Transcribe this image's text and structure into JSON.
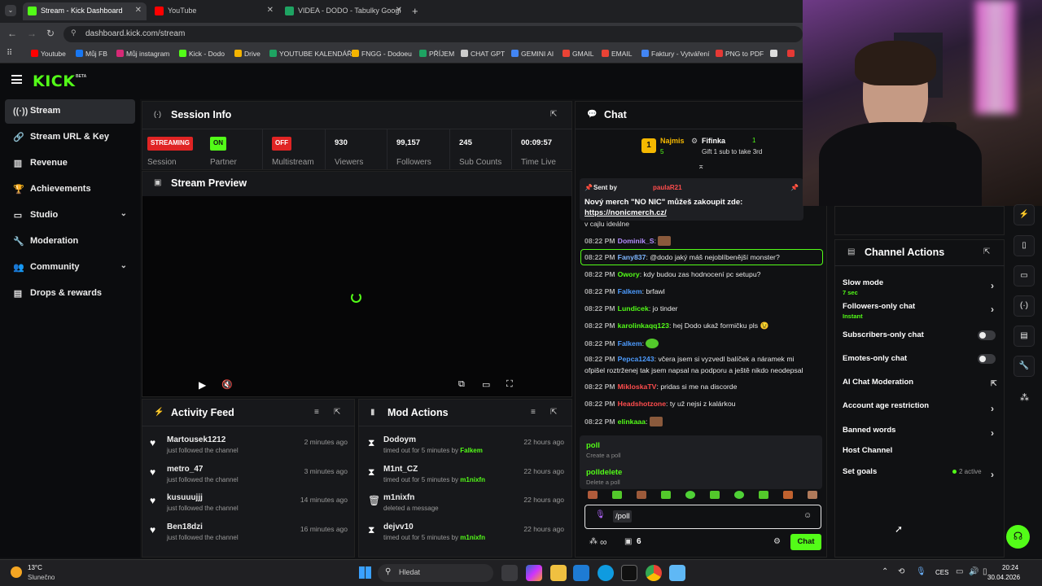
{
  "browser": {
    "tabs": [
      {
        "title": "Stream - Kick Dashboard",
        "color": "#53fc18"
      },
      {
        "title": "YouTube",
        "color": "#ff0000"
      },
      {
        "title": "VIDEA - DODO - Tabulky Googl",
        "color": "#1ea362"
      }
    ],
    "url": "dashboard.kick.com/stream",
    "bookmarks": [
      {
        "label": "Youtube",
        "color": "#ff0000"
      },
      {
        "label": "Můj FB",
        "color": "#1877f2"
      },
      {
        "label": "Můj instagram",
        "color": "#d62976"
      },
      {
        "label": "Kick - Dodo",
        "color": "#53fc18"
      },
      {
        "label": "Drive",
        "color": "#f4b400"
      },
      {
        "label": "YOUTUBE KALENDÁŘ",
        "color": "#1ea362"
      },
      {
        "label": "FNGG - Dodoeu",
        "color": "#f4b400"
      },
      {
        "label": "PŘÍJEM",
        "color": "#1ea362"
      },
      {
        "label": "CHAT GPT",
        "color": "#cccccc"
      },
      {
        "label": "GEMINI AI",
        "color": "#4285f4"
      },
      {
        "label": "GMAIL",
        "color": "#ea4335"
      },
      {
        "label": "EMAIL",
        "color": "#ea4335"
      },
      {
        "label": "Faktury - Vytváření",
        "color": "#4285f4"
      },
      {
        "label": "PNG to PDF",
        "color": "#e53935"
      },
      {
        "label": "",
        "color": "#dddddd"
      },
      {
        "label": "",
        "color": "#e53935"
      }
    ]
  },
  "brand": {
    "logo": "KICK",
    "beta": "BETA",
    "accent": "#53fc18"
  },
  "sidebar": {
    "items": [
      {
        "label": "Stream",
        "icon": "broadcast-icon"
      },
      {
        "label": "Stream URL & Key",
        "icon": "link-icon"
      },
      {
        "label": "Revenue",
        "icon": "chart-icon"
      },
      {
        "label": "Achievements",
        "icon": "trophy-icon"
      },
      {
        "label": "Studio",
        "icon": "monitor-icon"
      },
      {
        "label": "Moderation",
        "icon": "wrench-icon"
      },
      {
        "label": "Community",
        "icon": "users-icon"
      },
      {
        "label": "Drops & rewards",
        "icon": "gift-icon"
      }
    ]
  },
  "session": {
    "title": "Session Info",
    "streaming": "STREAMING",
    "streaming_label": "Session",
    "partner_badge": "ON",
    "partner_label": "Partner",
    "multistream_badge": "OFF",
    "multistream_label": "Multistream",
    "viewers": "930",
    "viewers_label": "Viewers",
    "followers": "99,157",
    "followers_label": "Followers",
    "subs": "245",
    "subs_label": "Sub Counts",
    "time": "00:09:57",
    "time_label": "Time Live"
  },
  "preview": {
    "title": "Stream Preview"
  },
  "activity": {
    "title": "Activity Feed",
    "items": [
      {
        "name": "Martousek1212",
        "action": "just followed the channel",
        "time": "2 minutes ago"
      },
      {
        "name": "metro_47",
        "action": "just followed the channel",
        "time": "3 minutes ago"
      },
      {
        "name": "kusuuujjj",
        "action": "just followed the channel",
        "time": "14 minutes ago"
      },
      {
        "name": "Ben18dzi",
        "action": "just followed the channel",
        "time": "16 minutes ago"
      }
    ]
  },
  "mod": {
    "title": "Mod Actions",
    "items": [
      {
        "name": "Dodoym",
        "action": "timed out for 5 minutes by",
        "by": "Falkem",
        "time": "22 hours ago"
      },
      {
        "name": "M1nt_CZ",
        "action": "timed out for 5 minutes by",
        "by": "m1nixfn",
        "time": "22 hours ago"
      },
      {
        "name": "m1nixfn",
        "action": "deleted a message",
        "by": "",
        "time": "22 hours ago"
      },
      {
        "name": "dejvv10",
        "action": "timed out for 5 minutes by",
        "by": "m1nixfn",
        "time": "22 hours ago"
      }
    ]
  },
  "chat": {
    "title": "Chat",
    "leaders": [
      {
        "name": "Najmis",
        "count": "5",
        "rank": "1"
      },
      {
        "name": "Fifinka",
        "count": "1",
        "note": "Gift 1 sub to take 3rd"
      }
    ],
    "pinned": {
      "sent_by": "Sent by",
      "user": "paulaR21",
      "text": "Nový merch \"NO NIC\" můžeš zakoupit zde:",
      "link": "https://nonicmerch.cz/"
    },
    "partial_line": "v cajlu ideálne",
    "messages": [
      {
        "time": "08:22 PM",
        "user": "Dominik_S",
        "color": "#b48cff",
        "text": ""
      },
      {
        "time": "08:22 PM",
        "user": "Fany837",
        "color": "#7eb6ff",
        "text": "@dodo jaký máš nejoblíbenější monster?"
      },
      {
        "time": "08:22 PM",
        "user": "Owory",
        "color": "#53fc18",
        "text": "kdy budou zas hodnocení pc setupu?"
      },
      {
        "time": "08:22 PM",
        "user": "Falkem",
        "color": "#4d9cff",
        "text": "brfawl"
      },
      {
        "time": "08:22 PM",
        "user": "Lundicek",
        "color": "#53fc18",
        "text": "jo tinder"
      },
      {
        "time": "08:22 PM",
        "user": "karolinkaqq123",
        "color": "#53fc18",
        "text": "hej Dodo ukaž formičku pls 😉"
      },
      {
        "time": "08:22 PM",
        "user": "Falkem",
        "color": "#4d9cff",
        "text": ""
      },
      {
        "time": "08:22 PM",
        "user": "Pepca1243",
        "color": "#4d9cff",
        "text": "včera jsem si vyzvedl balíček a náramek mi"
      },
      {
        "time": "",
        "user": "",
        "color": "#e8e8e8",
        "text": "ofpišel roztrženej tak jsem napsal na podporu a ještě nikdo neodepsal"
      },
      {
        "time": "08:22 PM",
        "user": "MikloskaTV",
        "color": "#ff4d4d",
        "text": "pridas si me na discorde"
      },
      {
        "time": "08:22 PM",
        "user": "Headshotzone",
        "color": "#ff4d4d",
        "text": "ty už nejsi z kalárkou"
      },
      {
        "time": "08:22 PM",
        "user": "elinkaaa",
        "color": "#53fc18",
        "text": ""
      }
    ],
    "commands": [
      {
        "name": "poll",
        "desc": "Create a poll"
      },
      {
        "name": "polldelete",
        "desc": "Delete a poll"
      }
    ],
    "input_value": "/poll",
    "viewers_icon_text": "∞",
    "gift_count": "6",
    "send_label": "Chat"
  },
  "channel_actions": {
    "title": "Channel Actions",
    "items": [
      {
        "label": "Slow mode",
        "sub": "7 sec",
        "type": "arrow"
      },
      {
        "label": "Followers-only chat",
        "sub": "Instant",
        "type": "arrow"
      },
      {
        "label": "Subscribers-only chat",
        "sub": "",
        "type": "toggle"
      },
      {
        "label": "Emotes-only chat",
        "sub": "",
        "type": "toggle"
      },
      {
        "label": "AI Chat Moderation",
        "sub": "",
        "type": "external"
      },
      {
        "label": "Account age restriction",
        "sub": "",
        "type": "arrow"
      },
      {
        "label": "Banned words",
        "sub": "",
        "type": "arrow"
      },
      {
        "label": "Host Channel",
        "sub": "",
        "type": "none"
      },
      {
        "label": "Set goals",
        "sub": "",
        "type": "arrow",
        "extra": "2 active"
      }
    ]
  },
  "taskbar": {
    "weather_temp": "13°C",
    "weather_desc": "Slunečno",
    "search_placeholder": "Hledat",
    "lang": "CES",
    "time": "20:24",
    "date": "30.04.2026"
  }
}
